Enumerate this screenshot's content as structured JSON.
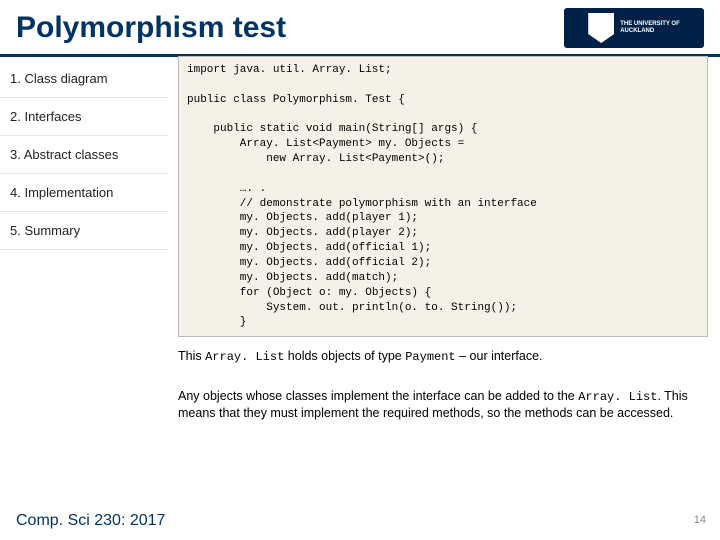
{
  "header": {
    "title": "Polymorphism test",
    "logo_top": "THE UNIVERSITY OF",
    "logo_bottom": "AUCKLAND"
  },
  "sidebar": {
    "items": [
      "1. Class diagram",
      "2. Interfaces",
      "3. Abstract classes",
      "4. Implementation",
      "5. Summary"
    ]
  },
  "code": "import java. util. Array. List;\n\npublic class Polymorphism. Test {\n\n    public static void main(String[] args) {\n        Array. List<Payment> my. Objects =\n            new Array. List<Payment>();\n\n        …. .\n        // demonstrate polymorphism with an interface\n        my. Objects. add(player 1);\n        my. Objects. add(player 2);\n        my. Objects. add(official 1);\n        my. Objects. add(official 2);\n        my. Objects. add(match);\n        for (Object o: my. Objects) {\n            System. out. println(o. to. String());\n        }",
  "body": {
    "p1_a": "This ",
    "p1_code1": "Array. List",
    "p1_b": " holds objects of type ",
    "p1_code2": "Payment",
    "p1_c": " – our interface.",
    "p2_a": "Any objects whose classes implement the interface can be added to the ",
    "p2_code1": "Array. List",
    "p2_b": ". This means that they must implement the required methods, so the methods can be accessed."
  },
  "footer": {
    "course": "Comp. Sci 230: 2017",
    "page": "14"
  }
}
